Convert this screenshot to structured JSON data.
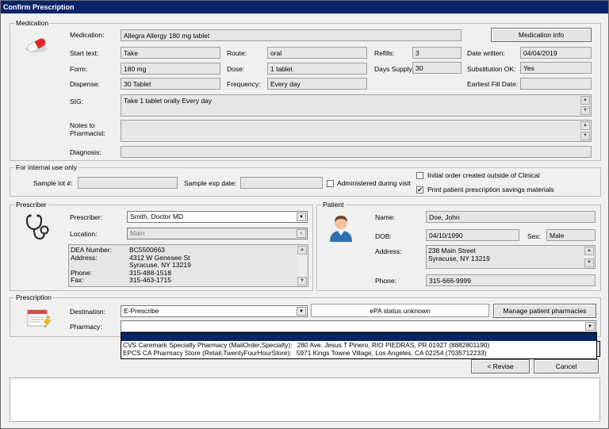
{
  "window": {
    "title": "Confirm Prescription"
  },
  "medication": {
    "section_title": "Medication",
    "medication_label": "Medication:",
    "medication_value": "Allegra Allergy 180 mg tablet",
    "info_button": "Medication info",
    "start_text_label": "Start text:",
    "start_text_value": "Take",
    "route_label": "Route:",
    "route_value": "oral",
    "refills_label": "Refills:",
    "refills_value": "3",
    "date_written_label": "Date written:",
    "date_written_value": "04/04/2019",
    "form_label": "Form:",
    "form_value": "180 mg",
    "dose_label": "Dose:",
    "dose_value": "1 tablet",
    "days_supply_label": "Days Supply:",
    "days_supply_value": "30",
    "substitution_label": "Substitution OK:",
    "substitution_value": "Yes",
    "dispense_label": "Dispense:",
    "dispense_value": "30 Tablet",
    "frequency_label": "Frequency:",
    "frequency_value": "Every day",
    "earliest_fill_label": "Earliest Fill Date:",
    "earliest_fill_value": "",
    "sig_label": "SIG:",
    "sig_value": "Take 1 tablet orally Every day",
    "notes_label": "Notes to\nPharmacist:",
    "notes_value": "",
    "diagnosis_label": "Diagnosis:",
    "diagnosis_value": ""
  },
  "internal": {
    "section_title": "For internal use only",
    "sample_lot_label": "Sample lot #:",
    "sample_lot_value": "",
    "sample_exp_label": "Sample exp date:",
    "sample_exp_value": "",
    "administered_label": "Administered during visit",
    "administered_checked": false,
    "initial_order_label": "Initial order created outside of Clinical",
    "initial_order_checked": false,
    "print_savings_label": "Print patient prescription savings materials",
    "print_savings_checked": true
  },
  "prescriber": {
    "section_title": "Prescriber",
    "prescriber_label": "Prescriber:",
    "prescriber_value": "Smith, Doctor MD",
    "location_label": "Location:",
    "location_value": "Main",
    "details_keys": "DEA Number:\nAddress:\n\nPhone:\nFax:",
    "details_values": "BC5500663\n4312 W Genesee St\nSyracuse, NY 13219\n315-488-1518\n315-463-1715"
  },
  "patient": {
    "section_title": "Patient",
    "name_label": "Name:",
    "name_value": "Doe, John",
    "dob_label": "DOB:",
    "dob_value": "04/10/1990",
    "sex_label": "Sex:",
    "sex_value": "Male",
    "address_label": "Address:",
    "address_value": "238 Main Street\nSyracuse, NY 13219",
    "phone_label": "Phone:",
    "phone_value": "315-666-9999"
  },
  "prescription": {
    "section_title": "Prescription",
    "destination_label": "Destination:",
    "destination_value": "E-Prescribe",
    "epa_status": "ePA status unknown",
    "manage_button": "Manage patient pharmacies",
    "pharmacy_label": "Pharmacy:",
    "pharmacy_value": "",
    "pharmacy_options": [
      {
        "name": "CVS Caremark Specialty Pharmacy (MailOrder,Specialty):",
        "address": "280 Ave. Jesus T Pinero, RIO PIEDRAS, PR 01927 (8882801190)"
      },
      {
        "name": "EPCS CA Pharmacy Store (Retail,TwentyFourHourStore):",
        "address": "5971 Kings Towne Village, Los Angeles, CA 02254 (7035712233)"
      }
    ]
  },
  "footer": {
    "revise_button": "< Revise",
    "cancel_button": "Cancel"
  },
  "colors": {
    "titlebar": "#0a246a",
    "field_bg": "#e6e6e6",
    "window_bg": "#f0f0f0"
  },
  "icons": [
    "pill-capsule-icon",
    "stethoscope-icon",
    "patient-avatar-icon",
    "prescription-pad-icon",
    "checkmark-icon"
  ]
}
